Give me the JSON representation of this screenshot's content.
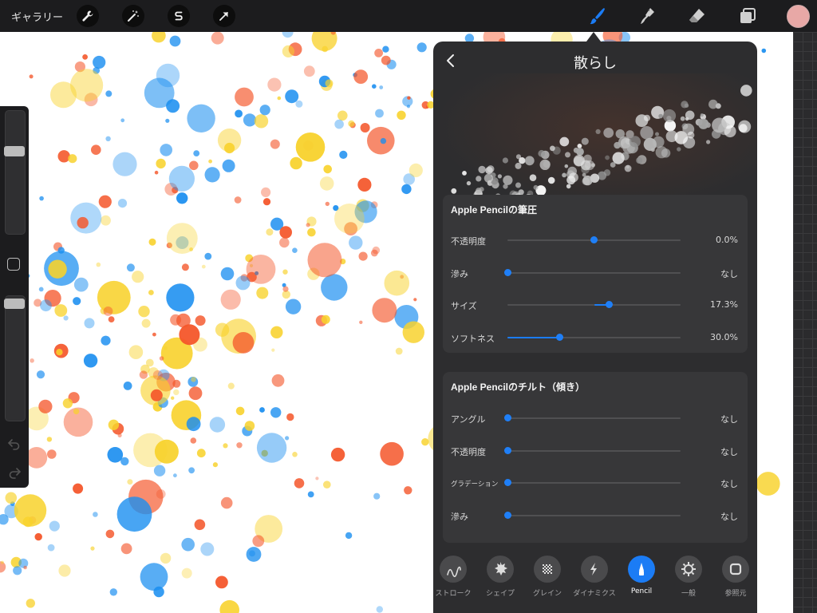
{
  "topbar": {
    "gallery_label": "ギャラリー",
    "tools_left": [
      {
        "icon": "wrench-icon"
      },
      {
        "icon": "magic-wand-icon"
      },
      {
        "icon": "selection-s-icon"
      },
      {
        "icon": "transform-arrow-icon"
      }
    ],
    "tools_right": [
      {
        "icon": "brush-icon",
        "active": true
      },
      {
        "icon": "smudge-icon"
      },
      {
        "icon": "eraser-icon"
      },
      {
        "icon": "layers-icon"
      }
    ],
    "current_color": "#e8a8a6"
  },
  "colors": {
    "accent": "#1b7cf5",
    "paint_blue": "#1a8ef0",
    "paint_orange": "#f4562a",
    "paint_yellow": "#f8d22c"
  },
  "panel": {
    "title": "散らし",
    "pressure_card": {
      "title": "Apple Pencilの筆圧",
      "rows": [
        {
          "label": "不透明度",
          "value": "0.0%",
          "level": 0.5,
          "bipolar": true
        },
        {
          "label": "滲み",
          "value": "なし",
          "level": 0.0,
          "bipolar": false
        },
        {
          "label": "サイズ",
          "value": "17.3%",
          "level": 0.587,
          "bipolar": true
        },
        {
          "label": "ソフトネス",
          "value": "30.0%",
          "level": 0.3,
          "bipolar": false
        }
      ]
    },
    "tilt_card": {
      "title": "Apple Pencilのチルト（傾き）",
      "rows": [
        {
          "label": "アングル",
          "value": "なし",
          "level": 0.0,
          "bipolar": false
        },
        {
          "label": "不透明度",
          "value": "なし",
          "level": 0.0,
          "bipolar": false
        },
        {
          "label": "グラデーション",
          "value": "なし",
          "level": 0.0,
          "bipolar": false
        },
        {
          "label": "滲み",
          "value": "なし",
          "level": 0.0,
          "bipolar": false
        }
      ]
    },
    "tabs": [
      {
        "label": "ストローク",
        "icon": "stroke-wave-icon"
      },
      {
        "label": "シェイプ",
        "icon": "shape-splat-icon"
      },
      {
        "label": "グレイン",
        "icon": "grain-checker-icon"
      },
      {
        "label": "ダイナミクス",
        "icon": "dynamics-bolt-icon"
      },
      {
        "label": "Pencil",
        "icon": "pencil-tip-icon",
        "active": true
      },
      {
        "label": "一般",
        "icon": "general-gear-icon"
      },
      {
        "label": "参照元",
        "icon": "source-square-icon"
      }
    ]
  }
}
